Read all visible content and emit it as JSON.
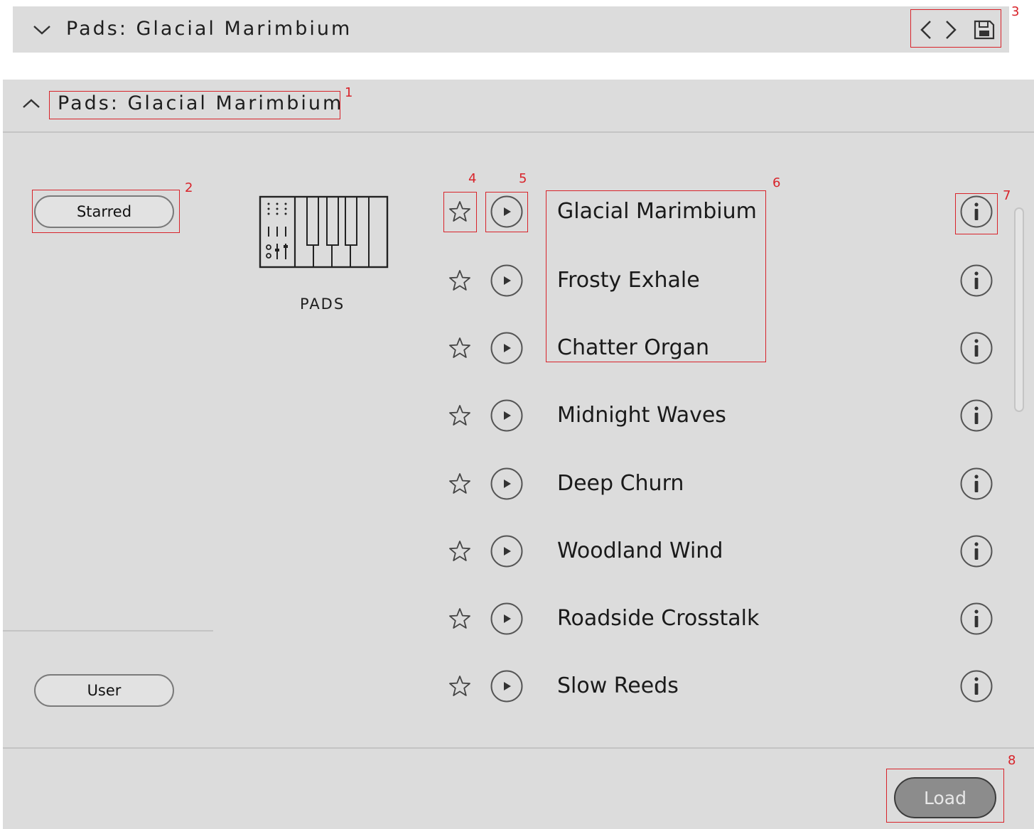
{
  "header_bar": {
    "title": "Pads: Glacial Marimbium"
  },
  "panel": {
    "title": "Pads: Glacial Marimbium"
  },
  "filters": {
    "starred_label": "Starred",
    "user_label": "User"
  },
  "category": {
    "label": "PADS",
    "icon": "keyboard-mixer-icon"
  },
  "presets": [
    {
      "name": "Glacial Marimbium"
    },
    {
      "name": "Frosty Exhale"
    },
    {
      "name": "Chatter Organ"
    },
    {
      "name": "Midnight Waves"
    },
    {
      "name": "Deep Churn"
    },
    {
      "name": "Woodland Wind"
    },
    {
      "name": "Roadside Crosstalk"
    },
    {
      "name": "Slow Reeds"
    }
  ],
  "footer": {
    "load_label": "Load"
  },
  "markers": [
    "1",
    "2",
    "3",
    "4",
    "5",
    "6",
    "7",
    "8"
  ],
  "colors": {
    "background": "#dcdcdc",
    "annotation": "#d8232a",
    "load_button": "#8c8c8c"
  }
}
